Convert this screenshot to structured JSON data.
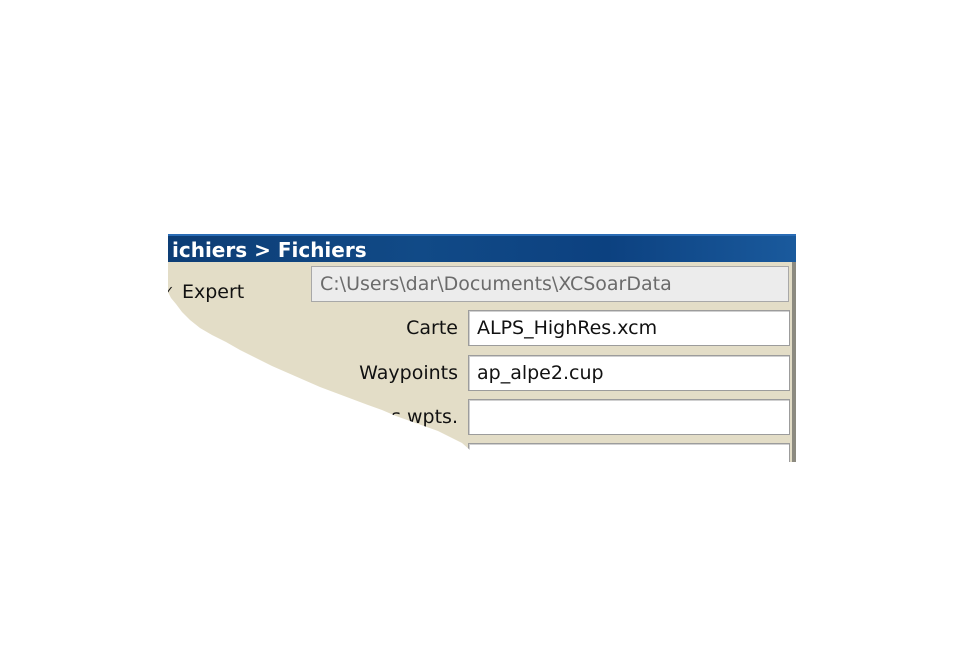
{
  "dialog": {
    "title": "ichiers > Fichiers",
    "expert_label": "Expert",
    "expert_checked": true,
    "data_path": "C:\\Users\\dar\\Documents\\XCSoarData",
    "rows": [
      {
        "label": "Carte",
        "value": "ALPS_HighRes.xcm"
      },
      {
        "label": "Waypoints",
        "value": "ap_alpe2.cup"
      },
      {
        "label": "s wpts.",
        "value": ""
      },
      {
        "label": "",
        "value": ""
      }
    ]
  }
}
